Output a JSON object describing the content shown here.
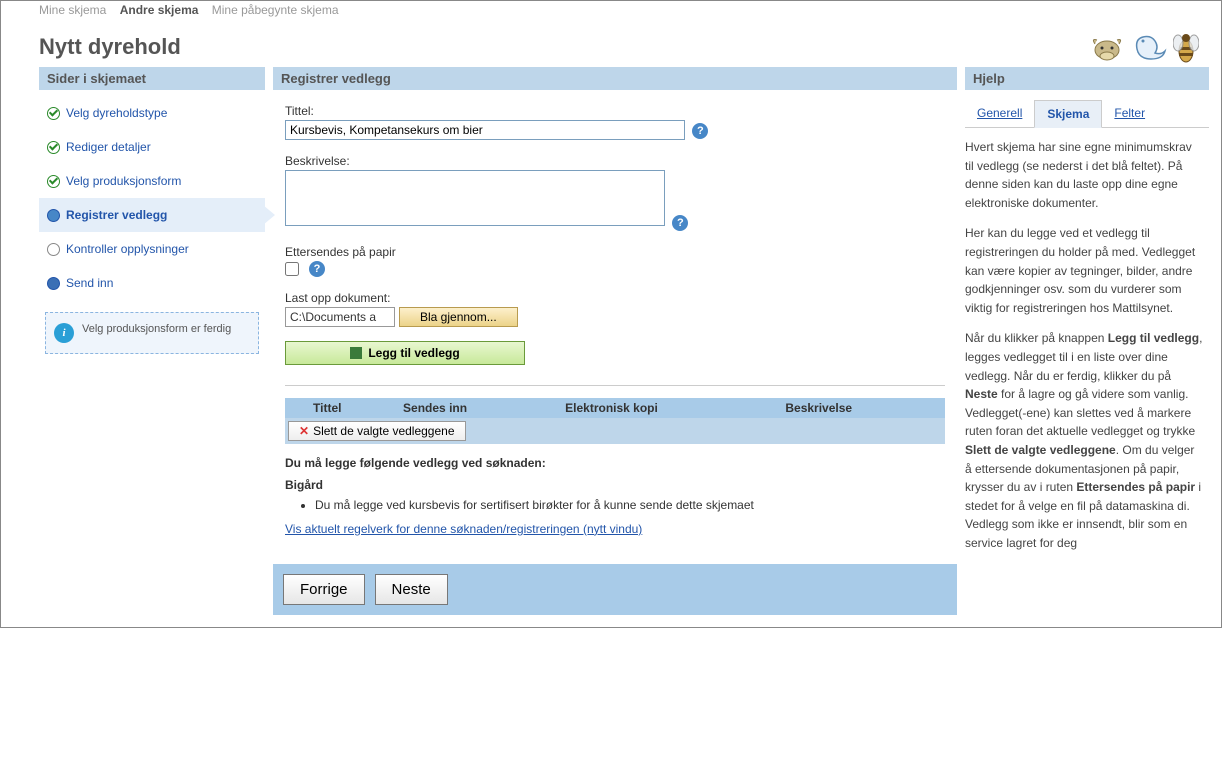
{
  "topTabs": {
    "mine": "Mine skjema",
    "andre": "Andre skjema",
    "pabegynte": "Mine påbegynte skjema"
  },
  "pageTitle": "Nytt dyrehold",
  "sidebar": {
    "header": "Sider i skjemaet",
    "items": [
      {
        "label": "Velg dyreholdstype",
        "state": "check"
      },
      {
        "label": "Rediger detaljer",
        "state": "check"
      },
      {
        "label": "Velg produksjonsform",
        "state": "check"
      },
      {
        "label": "Registrer vedlegg",
        "state": "current"
      },
      {
        "label": "Kontroller opplysninger",
        "state": "pending"
      },
      {
        "label": "Send inn",
        "state": "submit"
      }
    ],
    "infoBox": "Velg produksjonsform er ferdig"
  },
  "main": {
    "header": "Registrer vedlegg",
    "titleLabel": "Tittel:",
    "titleValue": "Kursbevis, Kompetansekurs om bier",
    "descLabel": "Beskrivelse:",
    "descValue": "",
    "paperLabel": "Ettersendes på papir",
    "uploadLabel": "Last opp dokument:",
    "filePath": "C:\\Documents a",
    "browseLabel": "Bla gjennom...",
    "addAttachLabel": "Legg til vedlegg",
    "tableHeaders": {
      "tittel": "Tittel",
      "sendes": "Sendes inn",
      "kopi": "Elektronisk kopi",
      "beskr": "Beskrivelse"
    },
    "deleteLabel": "Slett de valgte vedleggene",
    "requiredHeading": "Du må legge følgende vedlegg ved søknaden:",
    "requiredGroup": "Bigård",
    "requiredItem": "Du må legge ved kursbevis for sertifisert birøkter for å kunne sende dette skjemaet",
    "regLink": "Vis aktuelt regelverk for denne søknaden/registreringen (nytt vindu)",
    "prevLabel": "Forrige",
    "nextLabel": "Neste"
  },
  "help": {
    "header": "Hjelp",
    "tabs": {
      "generell": "Generell",
      "skjema": "Skjema",
      "felter": "Felter"
    },
    "p1": "Hvert skjema har sine egne minimumskrav til vedlegg (se nederst i det blå feltet). På denne siden kan du laste opp dine egne elektroniske dokumenter.",
    "p2": "Her kan du legge ved et vedlegg til registreringen du holder på med. Vedlegget kan være kopier av tegninger, bilder, andre godkjenninger osv. som du vurderer som viktig for registreringen hos Mattilsynet.",
    "p3a": "Når du klikker på knappen ",
    "p3b": "Legg til vedlegg",
    "p3c": ", legges vedlegget til i en liste over dine vedlegg. Når du er ferdig, klikker du på ",
    "p3d": "Neste",
    "p3e": " for å lagre og gå videre som vanlig. Vedlegget(-ene) kan slettes ved å markere ruten foran det aktuelle vedlegget og trykke ",
    "p3f": "Slett de valgte vedleggene",
    "p3g": ". Om du velger å ettersende dokumentasjonen på papir, krysser du av i ruten ",
    "p3h": "Ettersendes på papir",
    "p3i": " i stedet for å velge en fil på datamaskina di. Vedlegg som ikke er innsendt, blir som en service lagret for deg"
  }
}
